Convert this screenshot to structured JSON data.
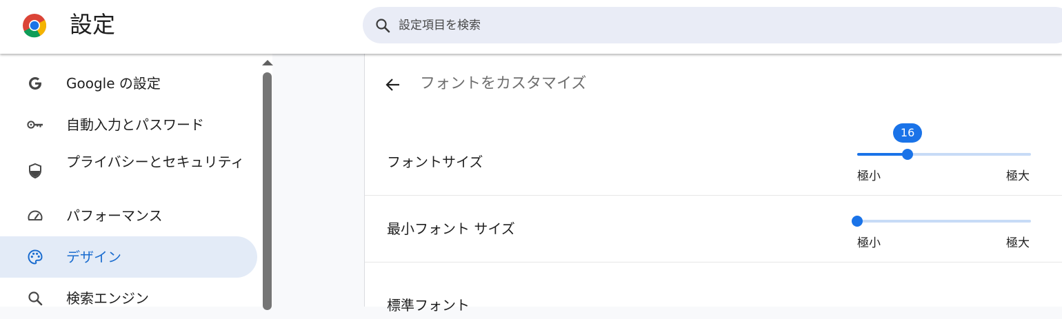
{
  "header": {
    "title": "設定",
    "search_placeholder": "設定項目を検索"
  },
  "sidebar": {
    "items": [
      {
        "label": "Google の設定",
        "icon": "google-g-icon"
      },
      {
        "label": "自動入力とパスワード",
        "icon": "key-icon"
      },
      {
        "label": "プライバシーとセキュリティ",
        "icon": "shield-icon"
      },
      {
        "label": "パフォーマンス",
        "icon": "speedometer-icon"
      },
      {
        "label": "デザイン",
        "icon": "palette-icon",
        "selected": true
      },
      {
        "label": "検索エンジン",
        "icon": "search-icon"
      }
    ]
  },
  "content": {
    "subpage_title": "フォントをカスタマイズ",
    "font_size": {
      "label": "フォントサイズ",
      "value": "16",
      "level": 0.29,
      "min_label": "極小",
      "max_label": "極大"
    },
    "min_font_size": {
      "label": "最小フォント サイズ",
      "level": 0.0,
      "min_label": "極小",
      "max_label": "極大"
    },
    "standard_font": {
      "label": "標準フォント"
    }
  },
  "colors": {
    "accent": "#1a73e8",
    "selected_bg": "#e3ebf7",
    "selected_text": "#1a6ccf"
  }
}
